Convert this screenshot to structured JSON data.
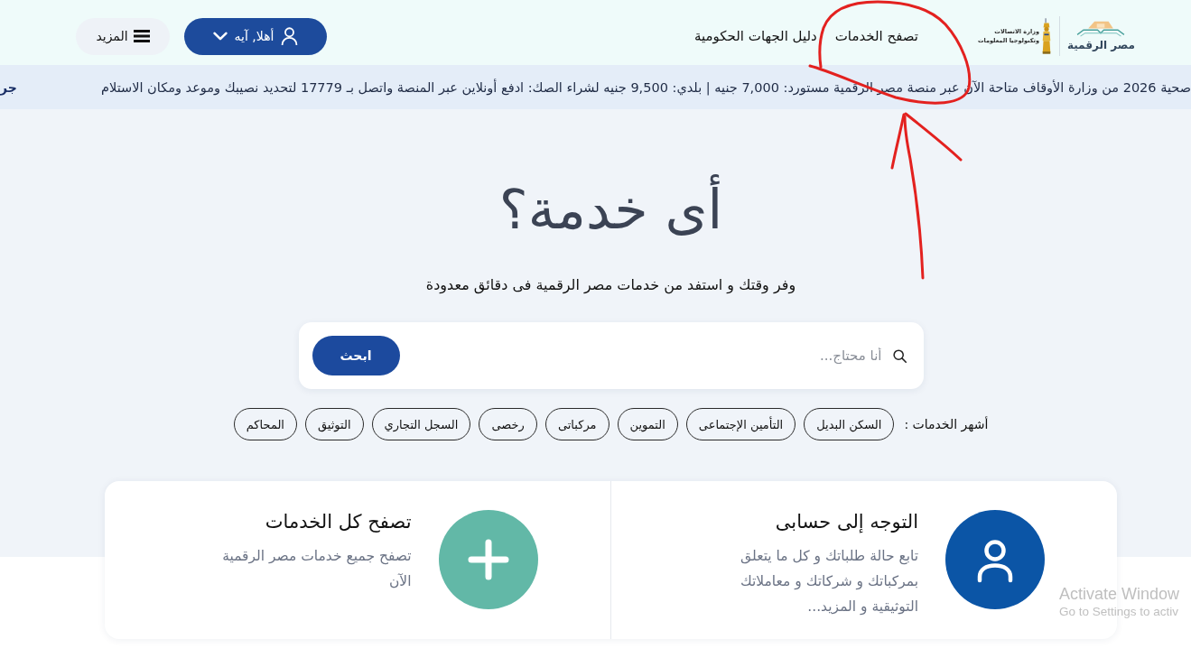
{
  "header": {
    "logo": {
      "text": "مصر الرقمية"
    },
    "ministry_logo": {
      "lines": [
        "وزارة الاتصالات",
        "وتكنولوجيا المعلومات"
      ]
    },
    "nav": [
      {
        "label": "تصفح الخدمات",
        "marked": true
      },
      {
        "label": "دليل الجهات الحكومية",
        "marked": false
      }
    ],
    "user_button": {
      "label": "أهلا, آيه"
    },
    "more_button": {
      "label": "المزيد"
    }
  },
  "ticker": [
    {
      "kind": "news",
      "text": "صحية 2026 من وزارة الأوقاف متاحة الآن عبر منصة مصر الرقمية مستورد: 7,000 جنيه | بلدي: 9,500 جنيه لشراء الصك: ادفع أونلاين عبر المنصة واتصل بـ 17779 لتحديد نصيبك وموعد ومكان الاستلام"
    },
    {
      "kind": "headline",
      "text": "جر"
    }
  ],
  "hero": {
    "title": "أى خدمة؟",
    "subtitle": "وفر وقتك و استفد من خدمات مصر الرقمية فى دقائق معدودة"
  },
  "search": {
    "placeholder": "أنا محتاج...",
    "button": "ابحث"
  },
  "popular": {
    "label": "أشهر الخدمات :",
    "chips": [
      "السكن البديل",
      "التأمين الإجتماعى",
      "التموين",
      "مركباتى",
      "رخصى",
      "السجل التجاري",
      "التوثيق",
      "المحاكم"
    ]
  },
  "cards": [
    {
      "kind": "account",
      "title": "التوجه إلى حسابى",
      "description": "تابع حالة طلباتك و كل ما يتعلق بمركباتك و شركاتك و معاملاتك التوثيقية و المزيد..."
    },
    {
      "kind": "browse",
      "title": "تصفح كل الخدمات",
      "description": "تصفح جميع خدمات مصر الرقمية الآن"
    }
  ],
  "os_watermark": {
    "title": "Activate Window",
    "subtitle": "Go to Settings to activ"
  }
}
